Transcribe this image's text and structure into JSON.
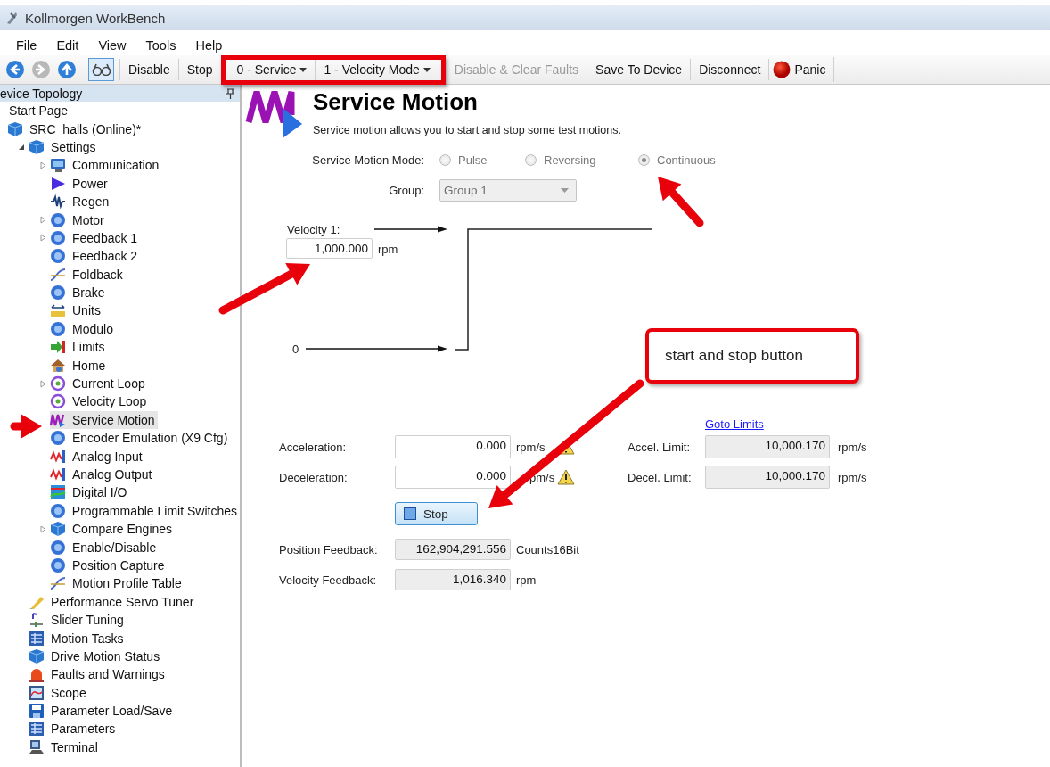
{
  "window": {
    "title": "Kollmorgen WorkBench"
  },
  "menu": [
    "File",
    "Edit",
    "View",
    "Tools",
    "Help"
  ],
  "toolbar": {
    "nav_buttons": [
      {
        "disabled": false
      },
      {
        "disabled": true
      },
      {
        "disabled": false
      }
    ],
    "view_toggle": {
      "on": true
    },
    "items": [
      {
        "kind": "button",
        "label": "Disable",
        "disabled": false
      },
      {
        "kind": "button",
        "label": "Stop",
        "disabled": false
      },
      {
        "kind": "dropdown",
        "label": "0 - Service"
      },
      {
        "kind": "dropdown",
        "label": "1 - Velocity Mode"
      },
      {
        "kind": "button",
        "label": "Disable & Clear Faults",
        "disabled": true
      },
      {
        "kind": "button",
        "label": "Save To Device",
        "disabled": false
      },
      {
        "kind": "button",
        "label": "Disconnect",
        "disabled": false
      },
      {
        "kind": "panic",
        "label": "Panic"
      }
    ]
  },
  "sidebar": {
    "title": "evice Topology",
    "tree": [
      {
        "label": "Start Page",
        "selected": false
      },
      {
        "label": "SRC_halls (Online)*",
        "selected": false,
        "children": [
          {
            "label": "Settings",
            "selected": false,
            "expanded": true,
            "children": [
              {
                "label": "Communication",
                "selected": false,
                "expanded": false
              },
              {
                "label": "Power",
                "selected": false
              },
              {
                "label": "Regen",
                "selected": false
              },
              {
                "label": "Motor",
                "selected": false,
                "expanded": false
              },
              {
                "label": "Feedback 1",
                "selected": false,
                "expanded": false
              },
              {
                "label": "Feedback 2",
                "selected": false
              },
              {
                "label": "Foldback",
                "selected": false
              },
              {
                "label": "Brake",
                "selected": false
              },
              {
                "label": "Units",
                "selected": false
              },
              {
                "label": "Modulo",
                "selected": false
              },
              {
                "label": "Limits",
                "selected": false
              },
              {
                "label": "Home",
                "selected": false
              },
              {
                "label": "Current Loop",
                "selected": false,
                "expanded": false
              },
              {
                "label": "Velocity Loop",
                "selected": false
              },
              {
                "label": "Service Motion",
                "selected": true
              },
              {
                "label": "Encoder Emulation (X9 Cfg)",
                "selected": false
              },
              {
                "label": "Analog Input",
                "selected": false
              },
              {
                "label": "Analog Output",
                "selected": false
              },
              {
                "label": "Digital I/O",
                "selected": false
              },
              {
                "label": "Programmable Limit Switches",
                "selected": false
              },
              {
                "label": "Compare Engines",
                "selected": false,
                "expanded": false
              },
              {
                "label": "Enable/Disable",
                "selected": false
              },
              {
                "label": "Position Capture",
                "selected": false
              },
              {
                "label": "Motion Profile Table",
                "selected": false
              }
            ]
          },
          {
            "label": "Performance Servo Tuner",
            "selected": false
          },
          {
            "label": "Slider Tuning",
            "selected": false
          },
          {
            "label": "Motion Tasks",
            "selected": false
          },
          {
            "label": "Drive Motion Status",
            "selected": false
          },
          {
            "label": "Faults and Warnings",
            "selected": false
          },
          {
            "label": "Scope",
            "selected": false
          },
          {
            "label": "Parameter Load/Save",
            "selected": false
          },
          {
            "label": "Parameters",
            "selected": false
          },
          {
            "label": "Terminal",
            "selected": false
          }
        ]
      }
    ]
  },
  "page": {
    "title": "Service Motion",
    "description": "Service motion allows you to start and stop some test motions.",
    "mode": {
      "label": "Service Motion Mode:",
      "disabled": true,
      "options": [
        {
          "label": "Pulse",
          "selected": false
        },
        {
          "label": "Reversing",
          "selected": false
        },
        {
          "label": "Continuous",
          "selected": true
        }
      ]
    },
    "group": {
      "label": "Group:",
      "value": "Group 1",
      "disabled": true
    },
    "profile": {
      "velocity_label": "Velocity 1:",
      "velocity_value": "1,000.000",
      "velocity_unit": "rpm",
      "zero_label": "0"
    },
    "goto_limits": "Goto Limits",
    "ramps": [
      {
        "label": "Acceleration:",
        "value": "0.000",
        "unit": "rpm/s",
        "warning": true,
        "limit_label": "Accel. Limit:",
        "limit_value": "10,000.170",
        "limit_unit": "rpm/s"
      },
      {
        "label": "Deceleration:",
        "value": "0.000",
        "unit": "pm/s",
        "warning": true,
        "limit_label": "Decel. Limit:",
        "limit_value": "10,000.170",
        "limit_unit": "rpm/s"
      }
    ],
    "stop_button": "Stop",
    "feedback": [
      {
        "label": "Position Feedback:",
        "value": "162,904,291.556",
        "unit": "Counts16Bit"
      },
      {
        "label": "Velocity Feedback:",
        "value": "1,016.340",
        "unit": "rpm"
      }
    ]
  },
  "annotations": {
    "callout": "start and stop button"
  }
}
